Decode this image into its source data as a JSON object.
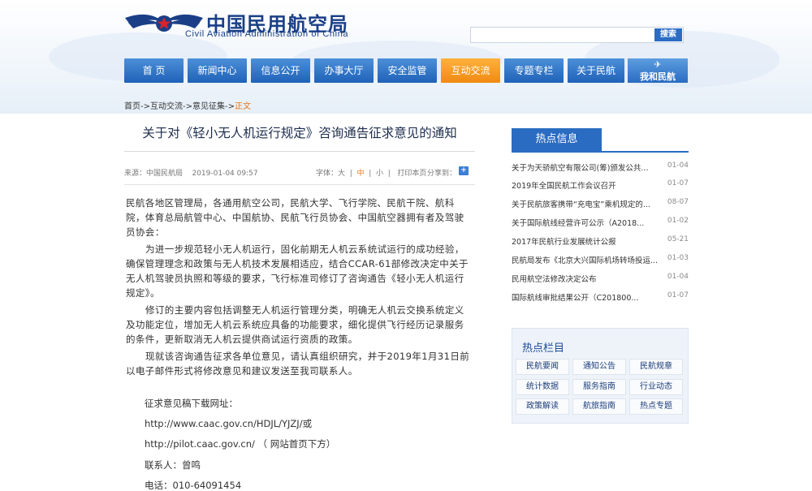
{
  "header": {
    "title_cn": "中国民用航空局",
    "title_en": "Civil Aviation Administration of China",
    "search_placeholder": "",
    "search_label": "搜索"
  },
  "nav": {
    "items": [
      "首 页",
      "新闻中心",
      "信息公开",
      "办事大厅",
      "安全监管",
      "互动交流",
      "专题专栏",
      "关于民航"
    ],
    "special": "我和民航"
  },
  "breadcrumb": {
    "items": [
      "首页",
      "互动交流",
      "意见征集"
    ],
    "separator": "->",
    "current": "正文"
  },
  "article": {
    "title": "关于对《轻小无人机运行规定》咨询通告征求意见的通知",
    "source": "来源：中国民航局",
    "date": "2019-01-04 09:57",
    "font_label": "字体：",
    "font_large": "大",
    "font_mid": "中",
    "font_small": "小",
    "print": "打印本页",
    "share_label": "分享到：",
    "paragraphs": [
      "民航各地区管理局，各通用航空公司，民航大学、飞行学院、民航干院、航科院，体育总局航管中心、中国航协、民航飞行员协会、中国航空器拥有者及驾驶员协会：",
      "为进一步规范轻小无人机运行，固化前期无人机云系统试运行的成功经验，确保管理理念和政策与无人机技术发展相适应，结合CCAR-61部修改决定中关于无人机驾驶员执照和等级的要求，飞行标准司修订了咨询通告《轻小无人机运行规定》。",
      "修订的主要内容包括调整无人机运行管理分类，明确无人机云交换系统定义及功能定位，增加无人机云系统应具备的功能要求，细化提供飞行经历记录服务的条件，更新取消无人机云提供商试运行资质的政策。",
      "现就该咨询通告征求各单位意见，请认真组织研究，并于2019年1月31日前以电子邮件形式将修改意见和建议发送至我司联系人。"
    ],
    "download_label": "征求意见稿下载网址：",
    "url1": "http://www.caac.gov.cn/HDJL/YJZJ/或",
    "url2": "http://pilot.caac.gov.cn/ （ 网站首页下方）",
    "contact": "联系人：曾鸣",
    "phone": "电话：010-64091454"
  },
  "sidebar": {
    "hot_title": "热点信息",
    "hot_items": [
      {
        "title": "关于为天骄航空有限公司(筹)颁发公共...",
        "date": "01-04"
      },
      {
        "title": "2019年全国民航工作会议召开",
        "date": "01-07"
      },
      {
        "title": "关于民航旅客携带“充电宝”乘机规定的...",
        "date": "08-07"
      },
      {
        "title": "关于国际航线经营许可公示（A2018...",
        "date": "01-02"
      },
      {
        "title": "2017年民航行业发展统计公报",
        "date": "05-21"
      },
      {
        "title": "民航局发布《北京大兴国际机场转场投运...",
        "date": "01-03"
      },
      {
        "title": "民用航空法修改决定公布",
        "date": "01-04"
      },
      {
        "title": "国际航线审批结果公开（C201800...",
        "date": "01-07"
      }
    ],
    "columns_title": "热点栏目",
    "columns": [
      "民航要闻",
      "通知公告",
      "民航规章",
      "统计数据",
      "服务指南",
      "行业动态",
      "政策解读",
      "航旅指南",
      "热点专题"
    ]
  },
  "colors": {
    "nav_blue": "#1f62b8",
    "nav_active": "#f08a12",
    "brand_blue": "#1a3f87",
    "accent_orange": "#e6761a"
  }
}
